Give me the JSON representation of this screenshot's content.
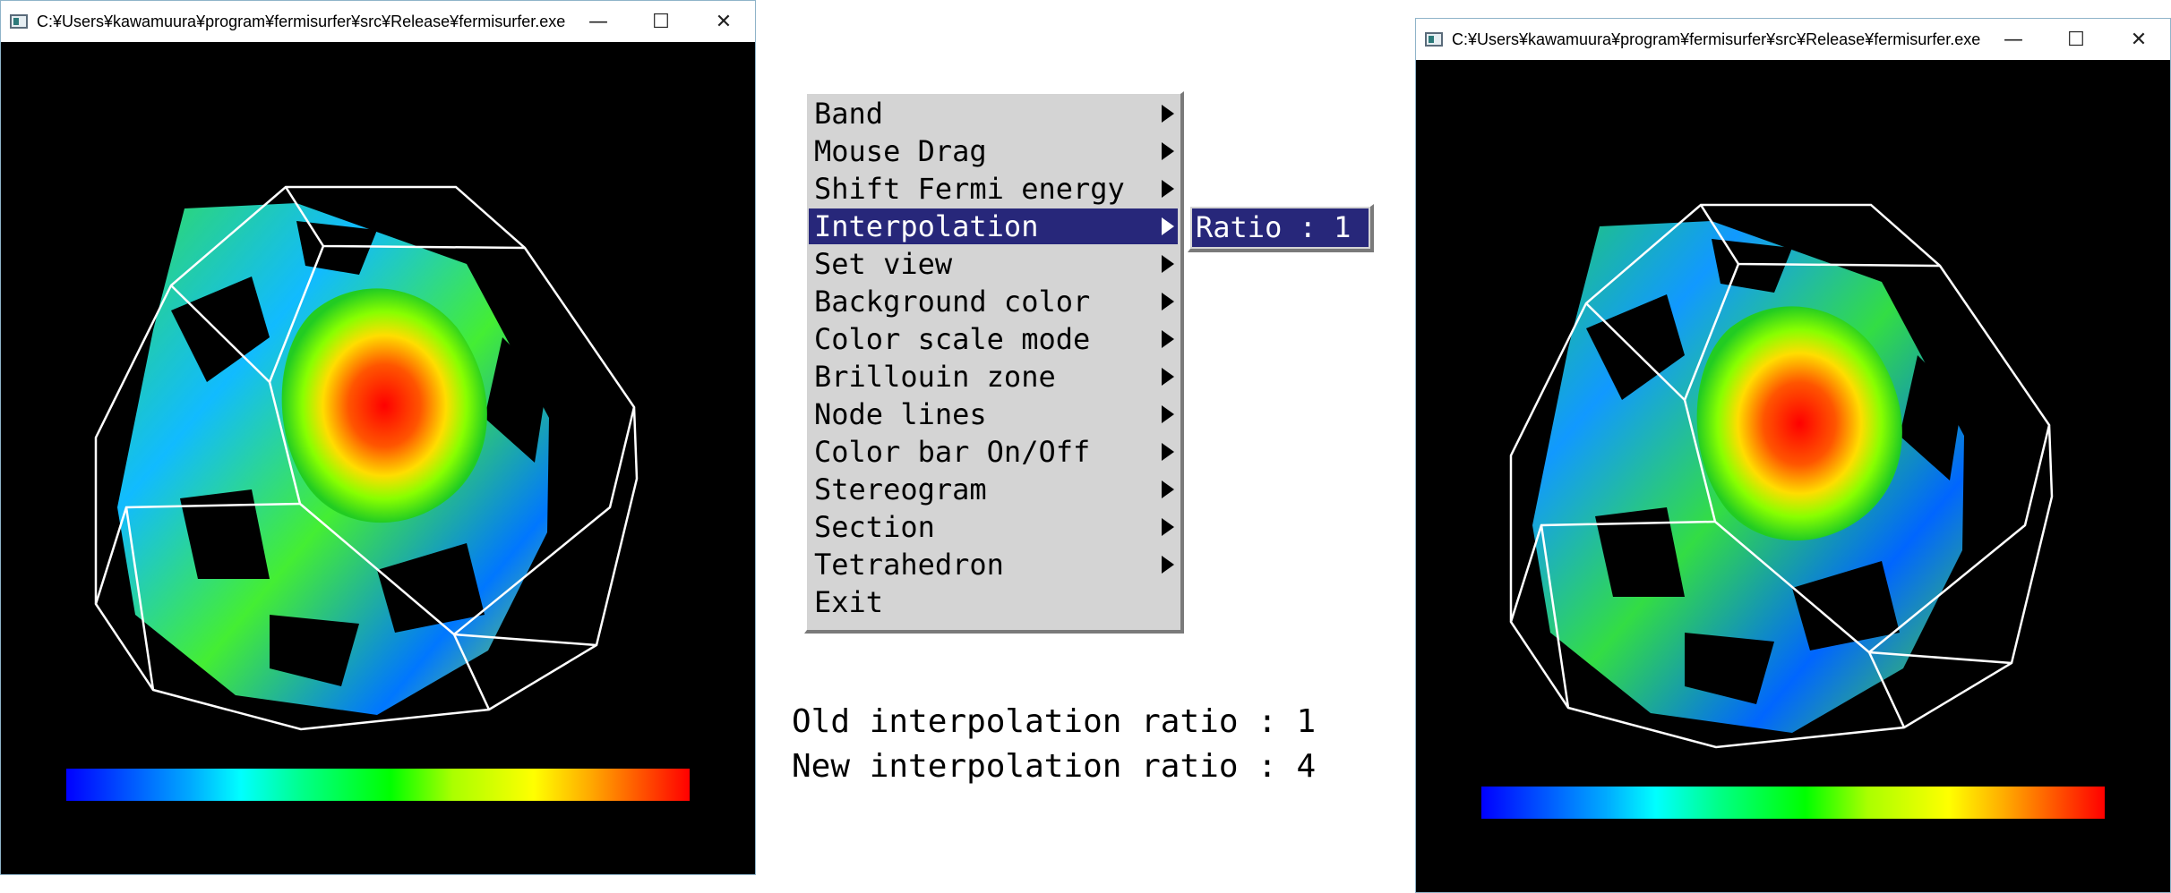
{
  "left_window": {
    "title": "C:¥Users¥kawamuura¥program¥fermisurfer¥src¥Release¥fermisurfer.exe",
    "minimize": "—",
    "maximize": "☐",
    "close": "✕"
  },
  "right_window": {
    "title": "C:¥Users¥kawamuura¥program¥fermisurfer¥src¥Release¥fermisurfer.exe",
    "minimize": "—",
    "maximize": "☐",
    "close": "✕"
  },
  "menu": {
    "items": [
      {
        "label": "Band"
      },
      {
        "label": "Mouse Drag"
      },
      {
        "label": "Shift Fermi energy"
      },
      {
        "label": "Interpolation"
      },
      {
        "label": "Set view"
      },
      {
        "label": "Background color"
      },
      {
        "label": "Color scale mode"
      },
      {
        "label": "Brillouin zone"
      },
      {
        "label": "Node lines"
      },
      {
        "label": "Color bar On/Off"
      },
      {
        "label": "Stereogram"
      },
      {
        "label": "Section"
      },
      {
        "label": "Tetrahedron"
      },
      {
        "label": "Exit"
      }
    ],
    "active_index": 3
  },
  "submenu": {
    "items": [
      {
        "label": "Ratio : 1"
      }
    ]
  },
  "notes": {
    "old": "Old interpolation ratio : 1",
    "new": "New interpolation ratio : 4"
  },
  "colors": {
    "menu_bg": "#d4d4d4",
    "menu_highlight": "#27277a",
    "viewport_bg": "#000000",
    "bz_edge": "#ffffff"
  },
  "icons": [
    "app-icon",
    "minimize-icon",
    "maximize-icon",
    "close-icon",
    "submenu-arrow-icon"
  ]
}
